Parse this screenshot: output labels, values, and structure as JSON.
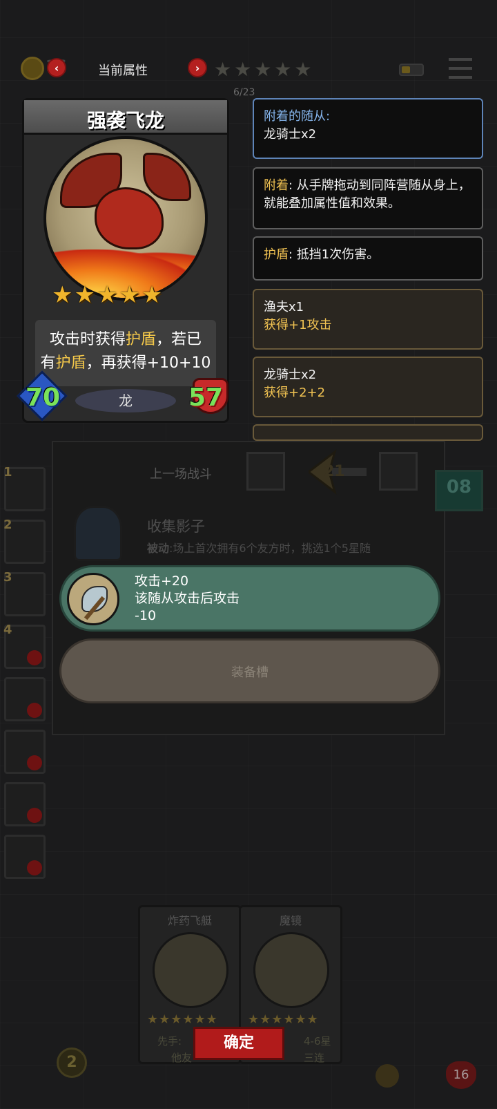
{
  "topbar": {
    "faded_level": "16",
    "attr_label": "当前属性",
    "prev_icon": "chevron-left",
    "next_icon": "chevron-right",
    "stars": "★★★★★",
    "progress": "6/23"
  },
  "card": {
    "name": "强袭飞龙",
    "stars": "★★★★★",
    "star_count": 5,
    "desc_line1_a": "攻击时获得",
    "desc_line1_hl": "护盾",
    "desc_line1_b": "，若已",
    "desc_line2_a": "有",
    "desc_line2_hl": "护盾",
    "desc_line2_b": "，再获得+10+10",
    "attack": "70",
    "health": "57",
    "tribe": "龙"
  },
  "info": {
    "attached_label": "附着的随从:",
    "attached_value": "龙骑士x2",
    "attach_rule_label": "附着",
    "attach_rule_text": ": 从手牌拖动到同阵营随从身上，就能叠加属性值和效果。",
    "shield_label": "护盾",
    "shield_text": ": 抵挡1次伤害。",
    "bonus1_title": "渔夫x1",
    "bonus1_gain": "获得+1攻击",
    "bonus2_title": "龙骑士x2",
    "bonus2_gain": "获得+2+2"
  },
  "panel": {
    "last_battle": "上一场战斗",
    "sword_value": "21",
    "skill_title": "收集影子",
    "skill_desc_label": "被动",
    "skill_desc": ":场上首次拥有6个友方时，挑选1个5星随",
    "counter": "08"
  },
  "equip": {
    "line1": "攻击+20",
    "line2": "该随从攻击后攻击",
    "line3": "-10",
    "slot_label": "装备槽"
  },
  "left_units": [
    "1",
    "2",
    "3",
    "4"
  ],
  "bottom": {
    "card1_name": "炸药飞艇",
    "card2_name": "魔镜",
    "card_stars": "★★★★★★",
    "confirm": "确定",
    "left_note1": "先手:",
    "left_note2": "他友",
    "right_note1": "4-6星",
    "right_note2": "三连",
    "badge": "2",
    "heart_value": "16"
  },
  "colors": {
    "highlight": "#f4c84a",
    "equip_bg": "#4a7566",
    "confirm_bg": "#b11b1b",
    "info_blue_border": "#5e84b8"
  }
}
